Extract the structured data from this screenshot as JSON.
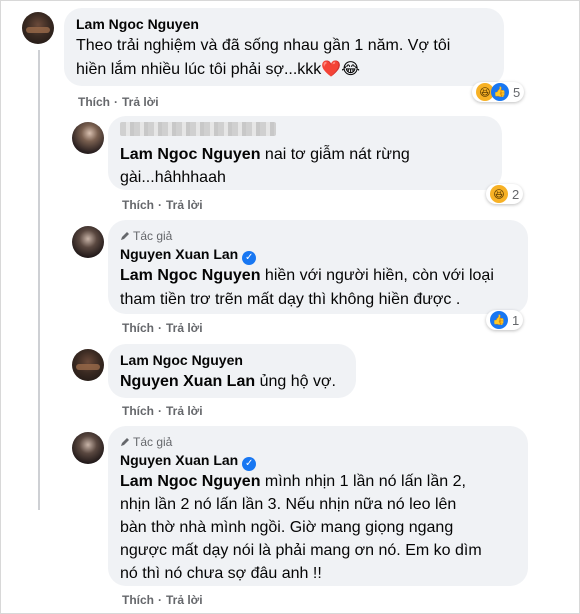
{
  "comments": [
    {
      "name": "Lam Ngoc Nguyen",
      "lines": [
        "Theo trải nghiệm và đã sống nhau gần 1 năm. Vợ tôi",
        "hiền lắm nhiều lúc tôi phải sợ...kkk"
      ],
      "emoji_suffix": "❤️😂",
      "like": "Thích",
      "reply": "Trả lời",
      "reactions": [
        "haha",
        "like"
      ],
      "reaction_count": "5"
    },
    {
      "mention": "Lam Ngoc Nguyen",
      "lines": [
        " nai tơ giẫm nát rừng",
        "gài...hâhhhaah"
      ],
      "like": "Thích",
      "reply": "Trả lời",
      "reactions": [
        "haha"
      ],
      "reaction_count": "2"
    },
    {
      "author_badge": "Tác giả",
      "name": "Nguyen Xuan Lan",
      "mention": "Lam Ngoc Nguyen",
      "lines": [
        " hiền với người hiền, còn với loại",
        "tham tiền trơ trẽn mất dạy thì không hiền được ."
      ],
      "like": "Thích",
      "reply": "Trả lời",
      "reactions": [
        "like"
      ],
      "reaction_count": "1"
    },
    {
      "name": "Lam Ngoc Nguyen",
      "mention": "Nguyen Xuan Lan",
      "lines": [
        " ủng hộ vợ."
      ],
      "like": "Thích",
      "reply": "Trả lời"
    },
    {
      "author_badge": "Tác giả",
      "name": "Nguyen Xuan Lan",
      "mention": "Lam Ngoc Nguyen",
      "lines": [
        " mình nhịn 1 lần nó lấn lần 2,",
        "nhịn lần 2 nó lấn lần 3. Nếu nhịn nữa nó leo lên",
        "bàn thờ nhà mình ngồi. Giờ mang giọng ngang",
        "ngược mất dạy nói là phải mang ơn nó. Em ko dìm",
        "nó thì nó chưa sợ đâu anh !!"
      ],
      "like": "Thích",
      "reply": "Trả lời"
    }
  ],
  "icons": {
    "haha": "haha-reaction-icon",
    "like": "like-reaction-icon",
    "verified": "verified-badge-icon",
    "pencil": "pencil-icon"
  },
  "colors": {
    "bubble": "#f0f2f5",
    "meta": "#65676b",
    "like_blue": "#1877f2",
    "haha_yellow": "#f7b125"
  }
}
